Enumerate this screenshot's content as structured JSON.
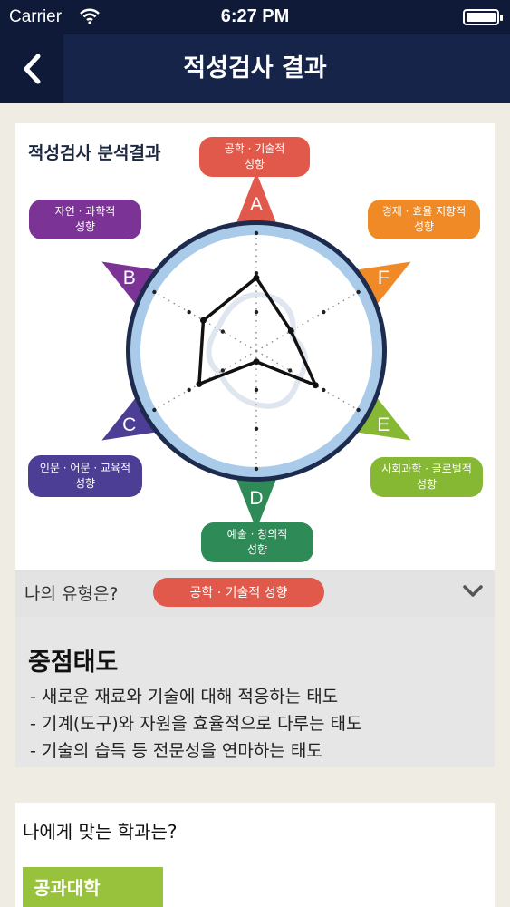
{
  "status_bar": {
    "carrier": "Carrier",
    "time": "6:27 PM"
  },
  "nav": {
    "title": "적성검사 결과",
    "back_icon": "chevron-left-icon"
  },
  "chart_card": {
    "title": "적성검사 분석결과",
    "axes": [
      {
        "letter": "A",
        "label_line1": "공학 · 기술적",
        "label_line2": "성향",
        "color": "#e0594a",
        "score": 0.62
      },
      {
        "letter": "F",
        "label_line1": "경제 · 효율 지향적",
        "label_line2": "성향",
        "color": "#ef8a26",
        "score": 0.34
      },
      {
        "letter": "E",
        "label_line1": "사회과학 · 글로벌적",
        "label_line2": "성향",
        "color": "#86b833",
        "score": 0.58
      },
      {
        "letter": "D",
        "label_line1": "예술 · 창의적",
        "label_line2": "성향",
        "color": "#2e8b57",
        "score": 0.09
      },
      {
        "letter": "C",
        "label_line1": "인문 · 어문 · 교육적",
        "label_line2": "성향",
        "color": "#4b3e94",
        "score": 0.56
      },
      {
        "letter": "B",
        "label_line1": "자연 · 과학적",
        "label_line2": "성향",
        "color": "#7b3496",
        "score": 0.52
      }
    ]
  },
  "type_panel": {
    "question": "나의 유형은?",
    "type_label": "공학 · 기술적 성향",
    "heading": "중점태도",
    "lines": [
      "- 새로운 재료와 기술에 대해 적응하는 태도",
      "- 기계(도구)와 자원을 효율적으로 다루는 태도",
      "- 기술의 습득 등 전문성을 연마하는 태도"
    ]
  },
  "dept_card": {
    "question": "나에게 맞는 학과는?",
    "college": "공과대학"
  }
}
